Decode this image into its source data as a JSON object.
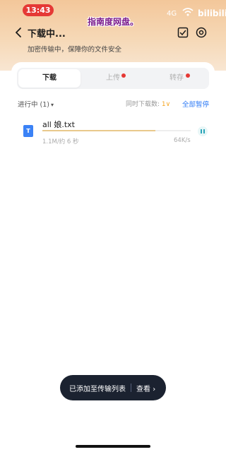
{
  "status_bar": {
    "time": "13:43",
    "signal": "4G",
    "brand": "bilibili"
  },
  "watermark": "指南度网盘。",
  "header": {
    "title": "下载中...",
    "subtitle": "加密传输中，保障你的文件安全"
  },
  "tabs": [
    {
      "label": "下载",
      "active": true,
      "badge": false
    },
    {
      "label": "上传",
      "active": false,
      "badge": true
    },
    {
      "label": "转存",
      "active": false,
      "badge": true
    }
  ],
  "section": {
    "label": "进行中 (1)",
    "concurrent_label": "同时下载数:",
    "concurrent_value": "1",
    "pause_all": "全部暂停"
  },
  "file": {
    "icon_letter": "T",
    "name": "all 娘.txt",
    "size_eta": "1.1M/约 6 秒",
    "speed": "64K/s",
    "progress_percent": 76
  },
  "toast": {
    "message": "已添加至传输列表",
    "action": "查看"
  },
  "colors": {
    "accent": "#2f7bf5",
    "badge": "#e53935",
    "progress": "#e9c98c",
    "toast_bg": "#1b2230"
  }
}
